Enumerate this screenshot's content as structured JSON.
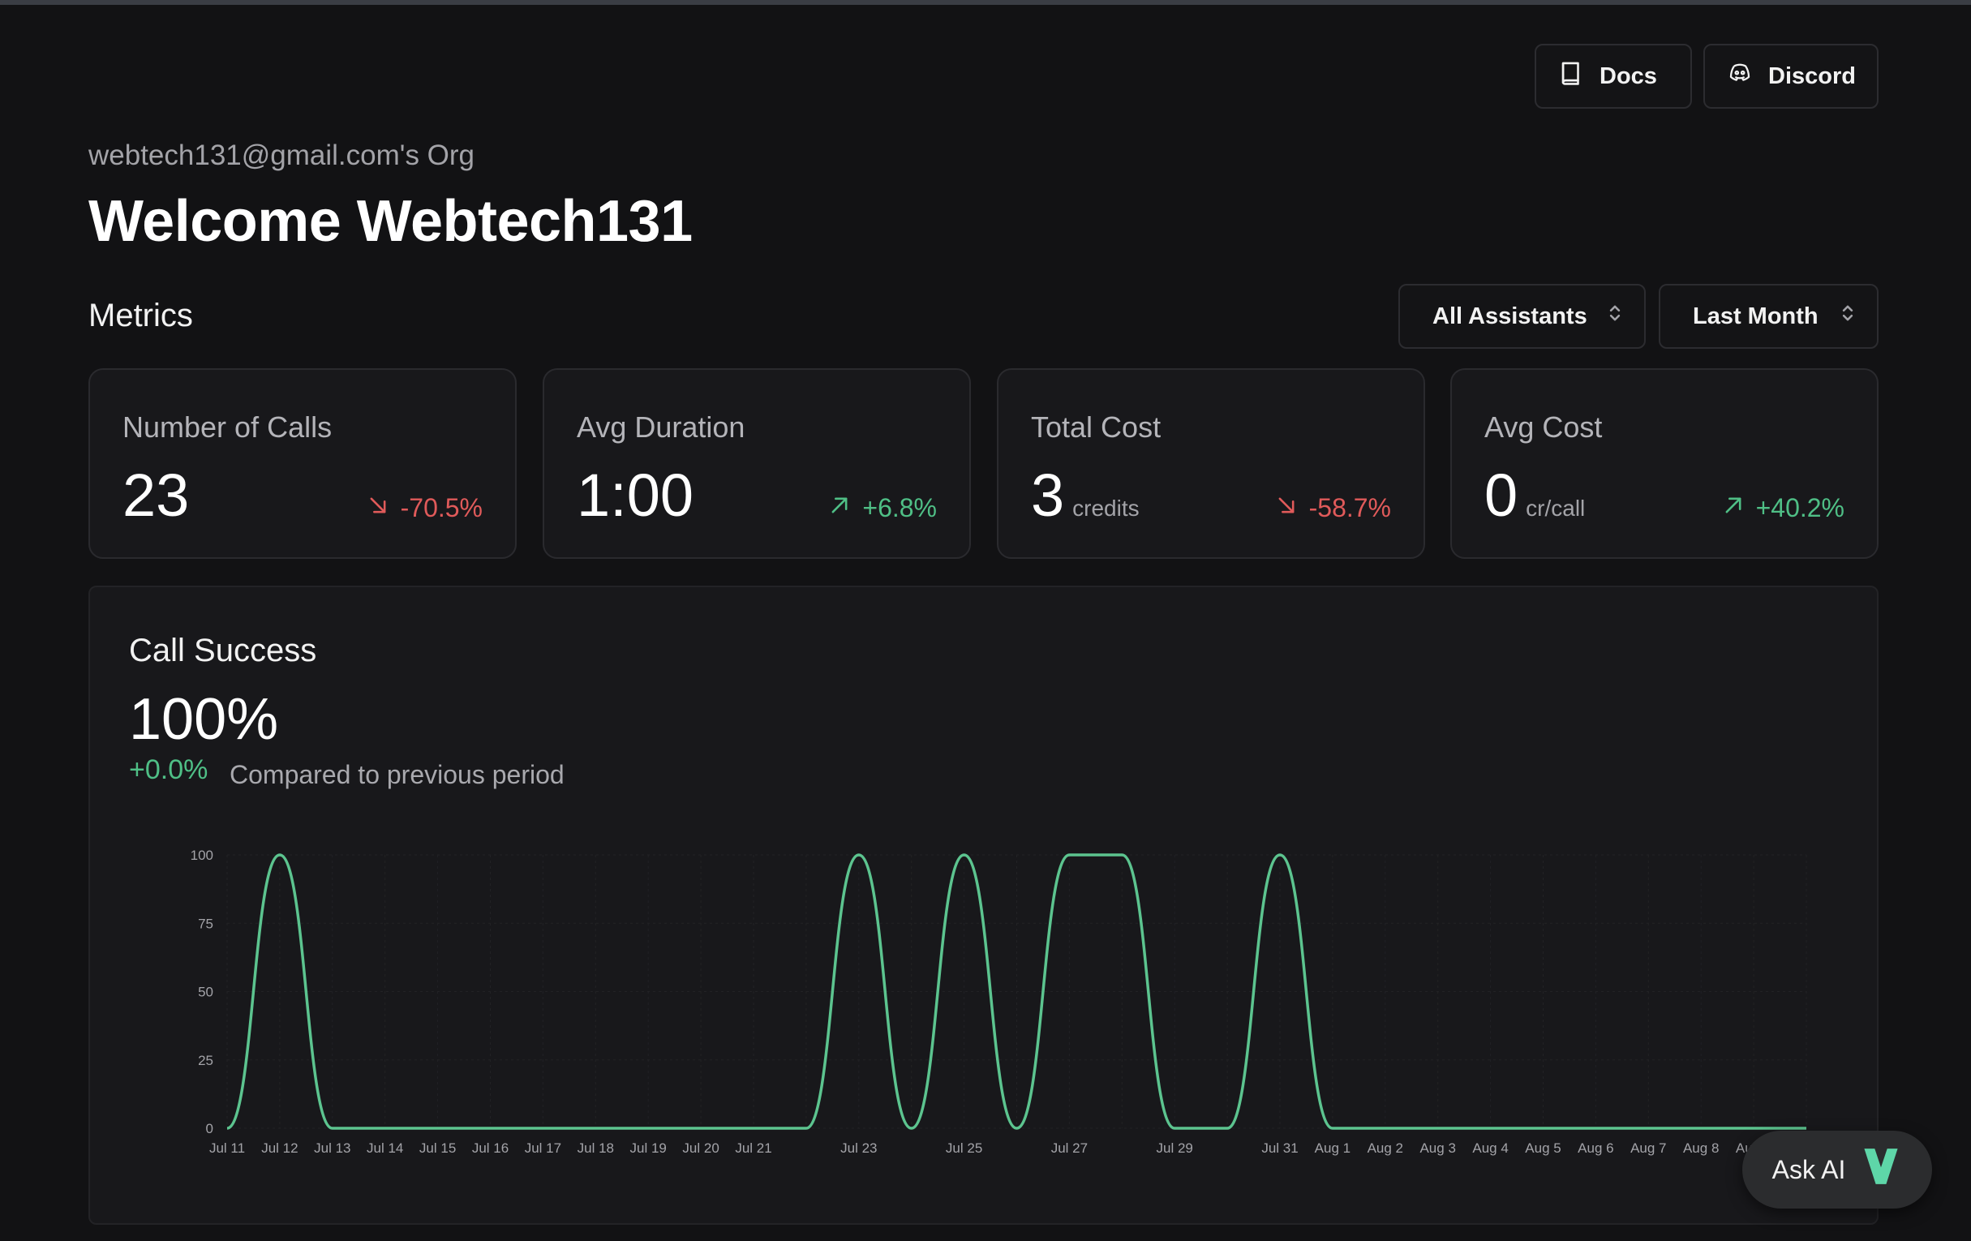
{
  "header": {
    "docs_label": "Docs",
    "discord_label": "Discord",
    "org": "webtech131@gmail.com's Org",
    "welcome": "Welcome Webtech131"
  },
  "metrics": {
    "title": "Metrics",
    "filters": {
      "assistant": "All Assistants",
      "period": "Last Month"
    },
    "cards": [
      {
        "title": "Number of Calls",
        "value": "23",
        "unit": "",
        "delta": "-70.5%",
        "trend": "down"
      },
      {
        "title": "Avg Duration",
        "value": "1:00",
        "unit": "",
        "delta": "+6.8%",
        "trend": "up"
      },
      {
        "title": "Total Cost",
        "value": "3",
        "unit": "credits",
        "delta": "-58.7%",
        "trend": "down"
      },
      {
        "title": "Avg Cost",
        "value": "0",
        "unit": "cr/call",
        "delta": "+40.2%",
        "trend": "up"
      }
    ]
  },
  "call_success": {
    "title": "Call Success",
    "value": "100%",
    "delta": "+0.0%",
    "compare_note": "Compared to previous period"
  },
  "colors": {
    "accent_green": "#4fbf86",
    "negative_red": "#e05a5a",
    "line_color": "#5cc48f"
  },
  "chart_data": {
    "type": "line",
    "title": "",
    "xlabel": "",
    "ylabel": "",
    "ylim": [
      0,
      100
    ],
    "yticks": [
      0,
      25,
      50,
      75,
      100
    ],
    "grid": true,
    "x": [
      "Jul 11",
      "Jul 12",
      "Jul 13",
      "Jul 14",
      "Jul 15",
      "Jul 16",
      "Jul 17",
      "Jul 18",
      "Jul 19",
      "Jul 20",
      "Jul 21",
      "Jul 22",
      "Jul 23",
      "Jul 24",
      "Jul 25",
      "Jul 26",
      "Jul 27",
      "Jul 28",
      "Jul 29",
      "Jul 30",
      "Jul 31",
      "Aug 1",
      "Aug 2",
      "Aug 3",
      "Aug 4",
      "Aug 5",
      "Aug 6",
      "Aug 7",
      "Aug 8",
      "Aug 9",
      "Aug 10"
    ],
    "x_tick_labels": [
      "Jul 11",
      "Jul 12",
      "Jul 13",
      "Jul 14",
      "Jul 15",
      "Jul 16",
      "Jul 17",
      "Jul 18",
      "Jul 19",
      "Jul 20",
      "Jul 21",
      "",
      "Jul 23",
      "",
      "Jul 25",
      "",
      "Jul 27",
      "",
      "Jul 29",
      "",
      "Jul 31",
      "Aug 1",
      "Aug 2",
      "Aug 3",
      "Aug 4",
      "Aug 5",
      "Aug 6",
      "Aug 7",
      "Aug 8",
      "Aug 9",
      ""
    ],
    "series": [
      {
        "values": [
          0,
          100,
          0,
          0,
          0,
          0,
          0,
          0,
          0,
          0,
          0,
          0,
          100,
          0,
          100,
          0,
          100,
          100,
          0,
          0,
          100,
          0,
          0,
          0,
          0,
          0,
          0,
          0,
          0,
          0,
          0
        ]
      }
    ]
  },
  "ask_ai": {
    "label": "Ask AI",
    "icon": "vapi-logo-icon"
  }
}
